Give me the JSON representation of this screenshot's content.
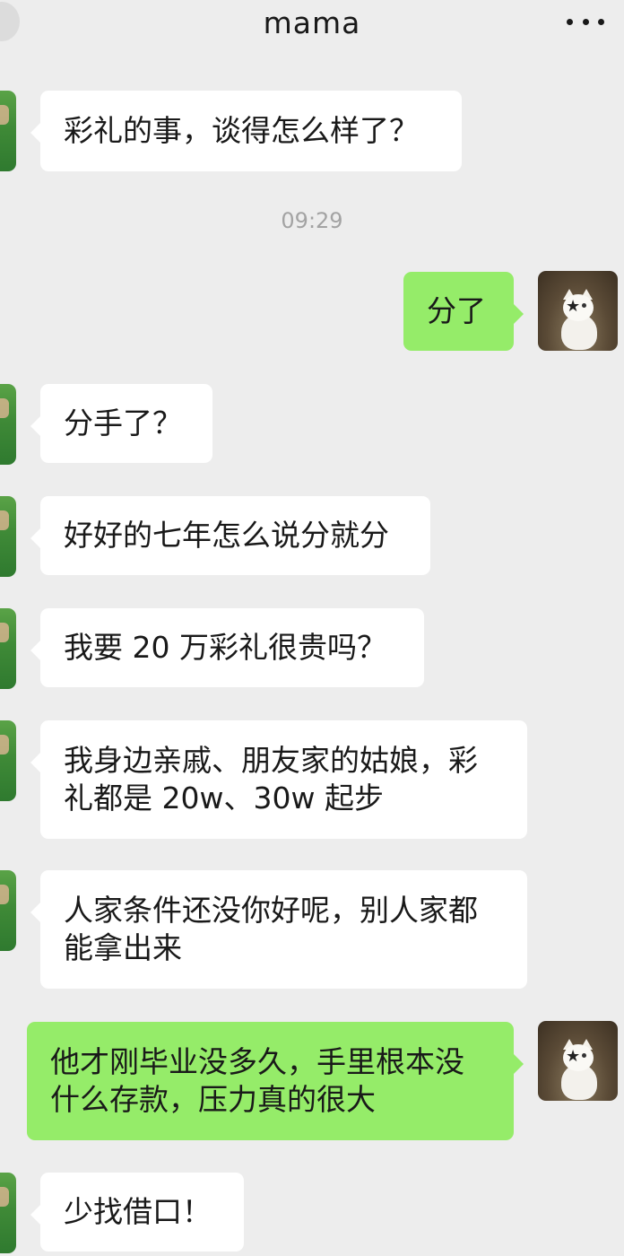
{
  "header": {
    "title": "mama"
  },
  "timestamp": "09:29",
  "messages": [
    {
      "side": "left",
      "text": "彩礼的事，谈得怎么样了？"
    },
    {
      "side": "right",
      "text": "分了"
    },
    {
      "side": "left",
      "text": "分手了？"
    },
    {
      "side": "left",
      "text": "好好的七年怎么说分就分"
    },
    {
      "side": "left",
      "text": "我要 20 万彩礼很贵吗？"
    },
    {
      "side": "left",
      "text": "我身边亲戚、朋友家的姑娘，彩礼都是 20w、30w 起步"
    },
    {
      "side": "left",
      "text": "人家条件还没你好呢，别人家都能拿出来"
    },
    {
      "side": "right",
      "text": "他才刚毕业没多久，手里根本没什么存款，压力真的很大"
    },
    {
      "side": "left",
      "text": "少找借口！"
    }
  ],
  "colors": {
    "background": "#ededed",
    "bubble_self": "#95ec69",
    "bubble_other": "#ffffff",
    "timestamp": "#a3a3a3"
  },
  "icons": {
    "more": "more-dots-icon",
    "back": "back-icon"
  }
}
